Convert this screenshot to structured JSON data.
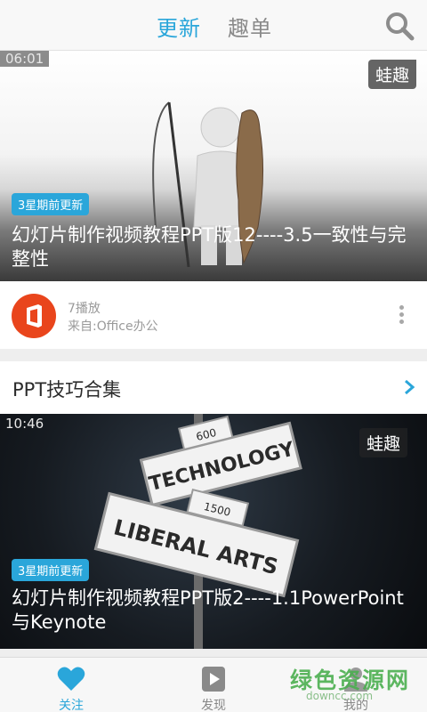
{
  "header": {
    "tabs": [
      {
        "label": "更新",
        "active": true
      },
      {
        "label": "趣单",
        "active": false
      }
    ],
    "search_icon": "search-icon"
  },
  "feed": {
    "video1": {
      "duration": "06:01",
      "watermark": "蛙趣",
      "badge": "3星期前更新",
      "title": "幻灯片制作视频教程PPT版12----3.5一致性与完整性"
    },
    "uploader": {
      "plays": "7播放",
      "source": "来自:Office办公",
      "logo_icon": "office-logo-icon",
      "more_icon": "more-vertical-icon"
    },
    "section": {
      "title": "PPT技巧合集",
      "arrow_icon": "chevron-right-icon"
    },
    "video2": {
      "duration": "10:46",
      "watermark": "蛙趣",
      "badge": "3星期前更新",
      "title": "幻灯片制作视频教程PPT版2----1.1PowerPoint与Keynote",
      "signs": [
        "TECHNOLOGY",
        "LIBERAL ARTS",
        "600",
        "1500"
      ]
    }
  },
  "bottom_nav": {
    "items": [
      {
        "label": "关注",
        "icon": "heart-icon",
        "active": true
      },
      {
        "label": "发现",
        "icon": "play-icon",
        "active": false
      },
      {
        "label": "我的",
        "icon": "user-icon",
        "active": false
      }
    ]
  },
  "site_watermark": {
    "text": "绿色资源网",
    "url": "downcc.com"
  },
  "colors": {
    "accent": "#2aa6da",
    "office_red": "#e9451c",
    "site_green": "#4caf50"
  }
}
